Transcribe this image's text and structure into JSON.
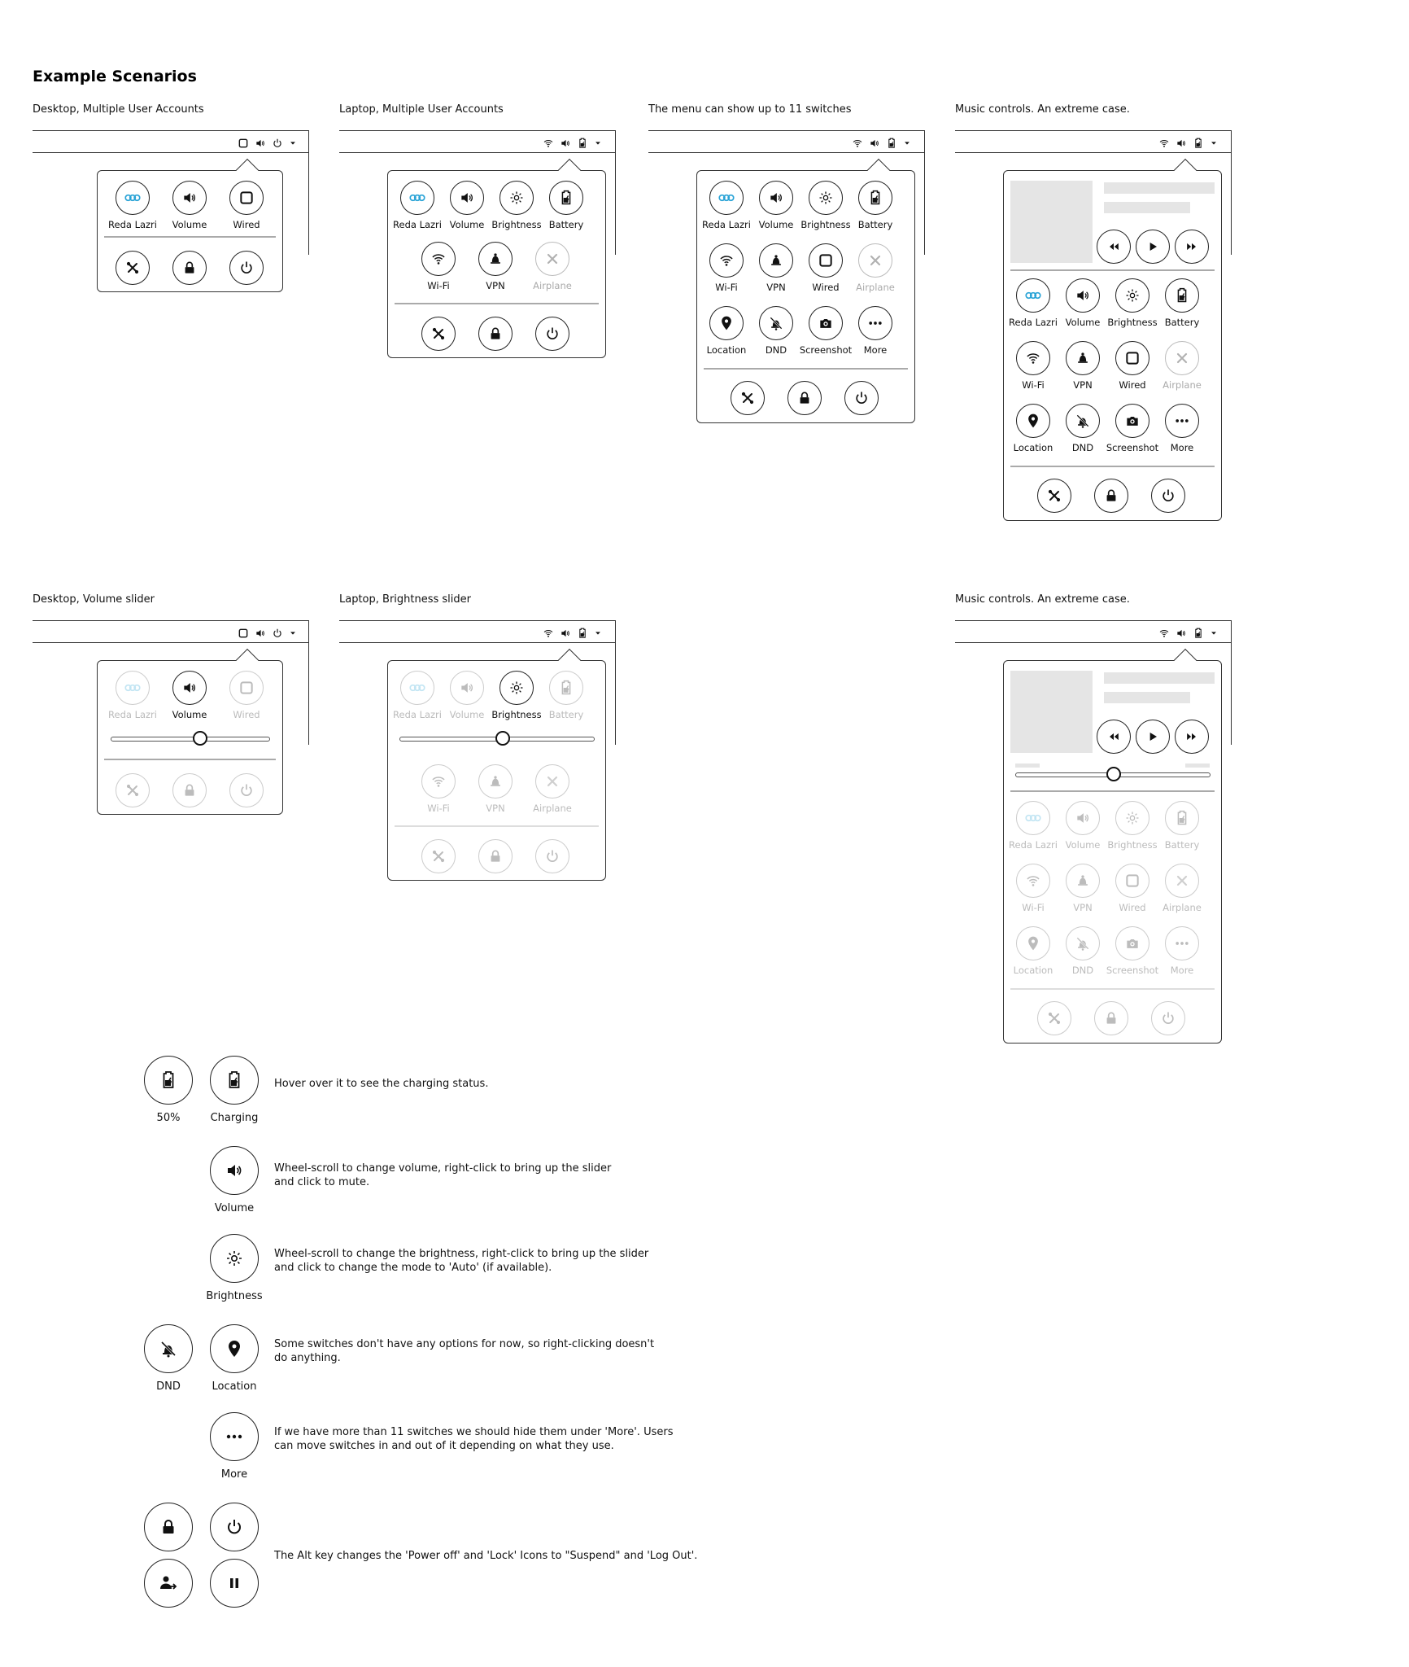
{
  "heading": "Example Scenarios",
  "scenarios": {
    "s1": "Desktop, Multiple User Accounts",
    "s2": "Laptop, Multiple User Accounts",
    "s3": "The menu can show up to 11 switches",
    "s4": "Music controls. An extreme case.",
    "s5": "Desktop, Volume slider",
    "s6": "Laptop, Brightness slider",
    "s7": "Music controls. An extreme case."
  },
  "labels": {
    "user": "Reda Lazri",
    "volume": "Volume",
    "wired": "Wired",
    "brightness": "Brightness",
    "battery": "Battery",
    "wifi": "Wi-Fi",
    "vpn": "VPN",
    "airplane": "Airplane",
    "location": "Location",
    "dnd": "DND",
    "screenshot": "Screenshot",
    "more": "More"
  },
  "legend": {
    "battery50": "50%",
    "charging": "Charging",
    "volume": "Volume",
    "brightness": "Brightness",
    "dnd": "DND",
    "location": "Location",
    "more": "More",
    "note_battery": "Hover over it to see the charging status.",
    "note_volume_1": "Wheel-scroll to change volume, right-click to bring up the slider",
    "note_volume_2": "and click to mute.",
    "note_brightness_1": "Wheel-scroll to change the brightness, right-click to bring up the slider",
    "note_brightness_2": "and click to change the mode to 'Auto' (if available).",
    "note_options_1": "Some switches don't have any options for now, so right-clicking doesn't",
    "note_options_2": "do anything.",
    "note_more_1": "If we have more than 11 switches we should hide them under 'More'. Users",
    "note_more_2": "can move switches in and out of it depending on what they use.",
    "note_alt": "The Alt key changes the 'Power off' and 'Lock' Icons to \"Suspend\" and 'Log Out'."
  },
  "accent": "#29a3d6"
}
